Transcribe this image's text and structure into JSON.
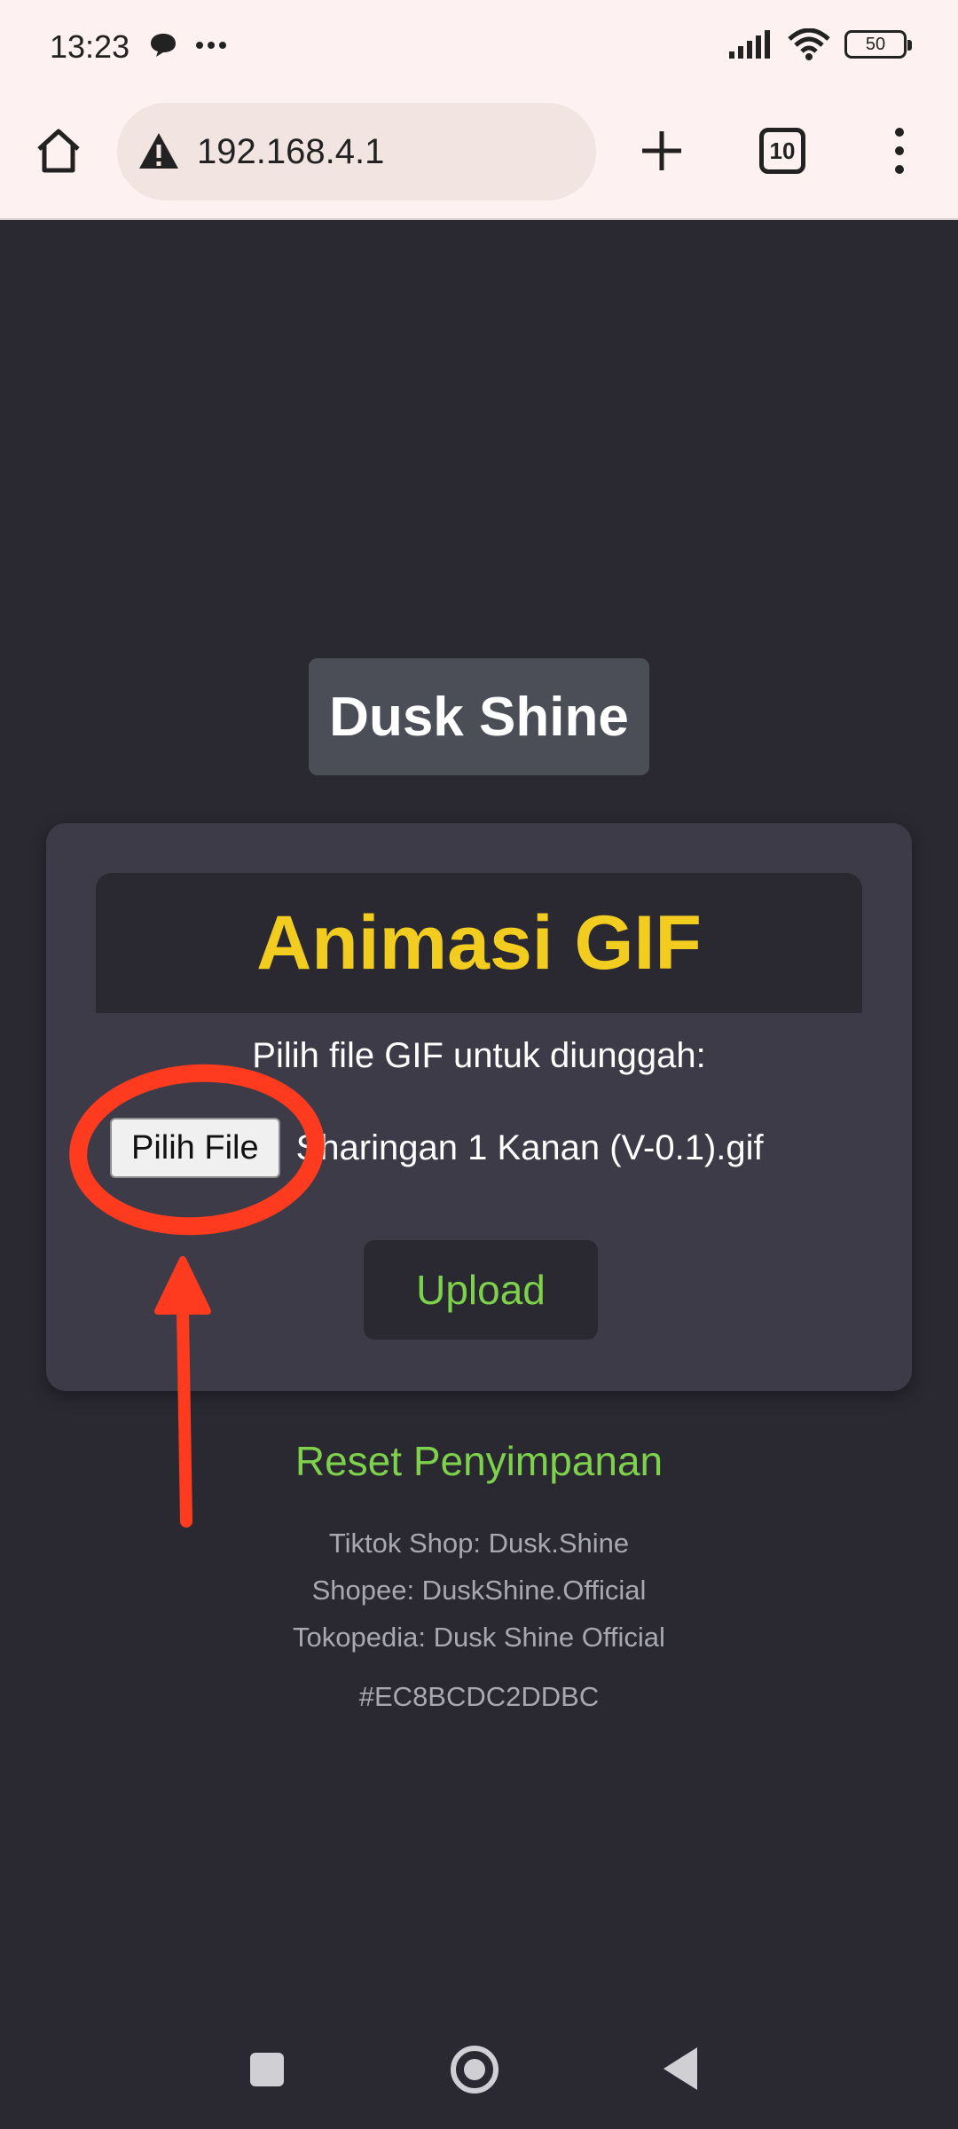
{
  "status_bar": {
    "time": "13:23",
    "battery": "50",
    "icons": [
      "chat-bubble-icon",
      "more-dots-icon",
      "signal-icon",
      "wifi-icon",
      "battery-icon"
    ]
  },
  "browser": {
    "url": "192.168.4.1",
    "tab_count": "10",
    "icons": [
      "home-icon",
      "warning-icon",
      "plus-icon",
      "tabs-icon",
      "menu-icon"
    ]
  },
  "page": {
    "brand": "Dusk Shine",
    "card": {
      "title": "Animasi GIF",
      "prompt": "Pilih file GIF untuk diunggah:",
      "file_button": "Pilih File",
      "file_name": "Sharingan 1 Kanan (V-0.1).gif",
      "upload_button": "Upload"
    },
    "reset_link": "Reset Penyimpanan",
    "footer": {
      "tiktok": "Tiktok Shop: Dusk.Shine",
      "shopee": "Shopee: DuskShine.Official",
      "tokopedia": "Tokopedia: Dusk Shine Official",
      "device_id": "#EC8BCDC2DDBC"
    }
  },
  "colors": {
    "page_bg": "#2a2932",
    "card_bg": "#3d3b47",
    "title_yellow": "#f2cc1e",
    "accent_green": "#7ed14b",
    "annotation_red": "#ff3b1f"
  }
}
